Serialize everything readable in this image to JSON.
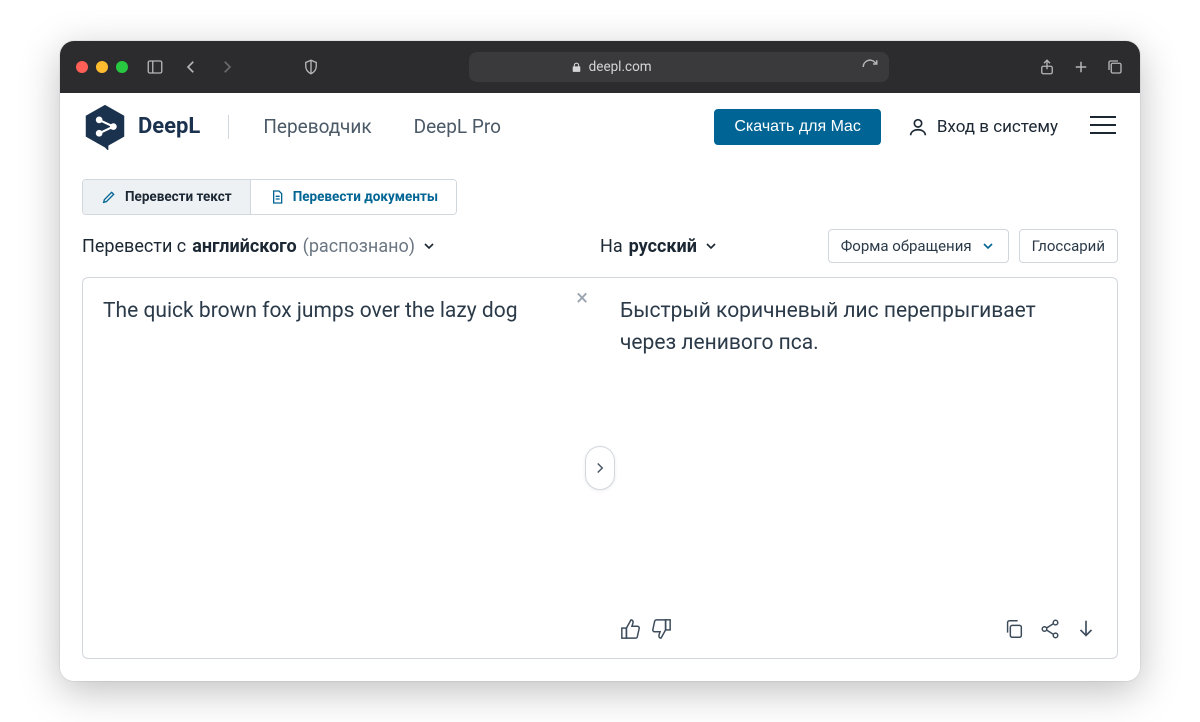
{
  "browser": {
    "url_host": "deepl.com"
  },
  "brand": {
    "name": "DeepL"
  },
  "nav": {
    "translator": "Переводчик",
    "pro": "DeepL Pro",
    "download_cta": "Скачать для Mac",
    "login": "Вход в систему"
  },
  "mode_tabs": {
    "text": "Перевести текст",
    "docs": "Перевести документы"
  },
  "source": {
    "prefix": "Перевести с ",
    "lang": "английского",
    "detected_suffix": " (распознано)",
    "text": "The quick brown fox jumps over the lazy dog"
  },
  "target": {
    "prefix": "На ",
    "lang": "русский",
    "formality": "Форма обращения",
    "glossary": "Глоссарий",
    "text": "Быстрый коричневый лис перепрыгивает через ленивого пса."
  }
}
